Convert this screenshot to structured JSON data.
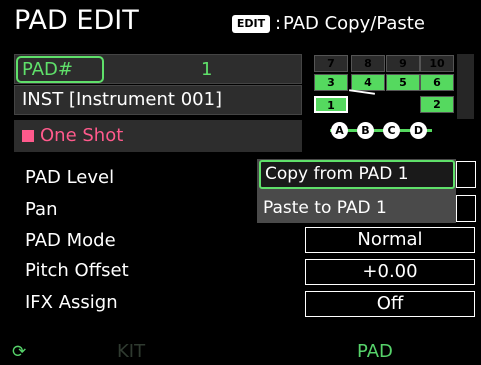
{
  "header": {
    "title": "PAD EDIT",
    "edit_badge": "EDIT",
    "separator": ":",
    "edit_action": "PAD Copy/Paste"
  },
  "pad": {
    "label": "PAD#",
    "number": "1",
    "inst": "INST [Instrument 001]",
    "mode_text": "One Shot"
  },
  "pad_grid": {
    "row1": [
      "7",
      "8",
      "9",
      "10"
    ],
    "row2": [
      "3",
      "4",
      "5",
      "6"
    ],
    "row3": [
      "1",
      "2"
    ],
    "knobs": [
      "A",
      "B",
      "C",
      "D"
    ],
    "selected": "1"
  },
  "params": [
    {
      "label": "PAD Level",
      "value": ""
    },
    {
      "label": "Pan",
      "value": ""
    },
    {
      "label": "PAD Mode",
      "value": "Normal"
    },
    {
      "label": "Pitch Offset",
      "value": "+0.00"
    },
    {
      "label": "IFX Assign",
      "value": "Off"
    }
  ],
  "popup": {
    "items": [
      "Copy from PAD 1",
      "Paste to PAD 1"
    ],
    "selected_index": 0
  },
  "footer": {
    "reload_icon": "⟳",
    "kit": "KIT",
    "pad": "PAD"
  },
  "colors": {
    "accent_green": "#5fe06a",
    "one_shot_pink": "#ff5a8c"
  }
}
